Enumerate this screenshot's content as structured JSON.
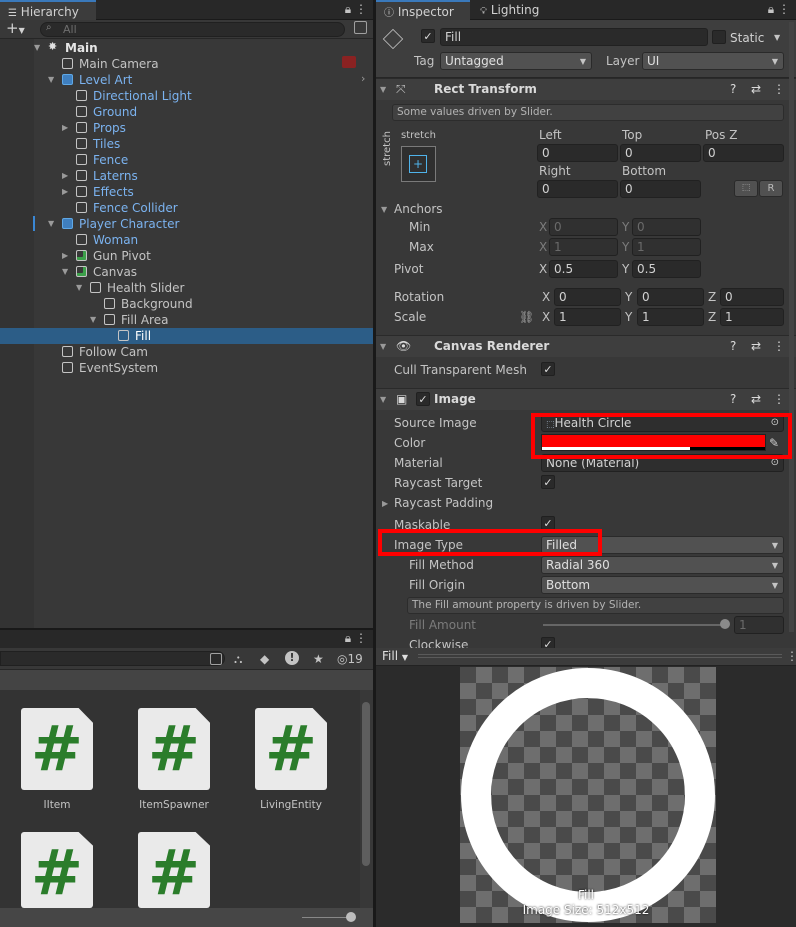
{
  "hierarchy": {
    "tab": "Hierarchy",
    "search_placeholder": "All",
    "items": [
      {
        "label": "Main",
        "indent": 0,
        "arrow": "down",
        "icon": "unity",
        "bold": true
      },
      {
        "label": "Main Camera",
        "indent": 1,
        "icon": "cube"
      },
      {
        "label": "Level Art",
        "indent": 1,
        "arrow": "down",
        "icon": "prefab",
        "blue": true
      },
      {
        "label": "Directional Light",
        "indent": 2,
        "icon": "cube",
        "blue": true
      },
      {
        "label": "Ground",
        "indent": 2,
        "icon": "cube",
        "blue": true
      },
      {
        "label": "Props",
        "indent": 2,
        "arrow": "right",
        "icon": "cube",
        "blue": true
      },
      {
        "label": "Tiles",
        "indent": 2,
        "icon": "cube",
        "blue": true
      },
      {
        "label": "Fence",
        "indent": 2,
        "icon": "cube",
        "blue": true
      },
      {
        "label": "Laterns",
        "indent": 2,
        "arrow": "right",
        "icon": "cube",
        "blue": true
      },
      {
        "label": "Effects",
        "indent": 2,
        "arrow": "right",
        "icon": "cube",
        "blue": true
      },
      {
        "label": "Fence Collider",
        "indent": 2,
        "icon": "cube",
        "blue": true
      },
      {
        "label": "Player Character",
        "indent": 1,
        "arrow": "down",
        "icon": "prefab",
        "blue": true
      },
      {
        "label": "Woman",
        "indent": 2,
        "icon": "cube",
        "blue": true
      },
      {
        "label": "Gun Pivot",
        "indent": 2,
        "arrow": "right",
        "icon": "cubeg"
      },
      {
        "label": "Canvas",
        "indent": 2,
        "arrow": "down",
        "icon": "cubeg"
      },
      {
        "label": "Health Slider",
        "indent": 3,
        "arrow": "down",
        "icon": "cube"
      },
      {
        "label": "Background",
        "indent": 4,
        "icon": "cube"
      },
      {
        "label": "Fill Area",
        "indent": 4,
        "arrow": "down",
        "icon": "cube"
      },
      {
        "label": "Fill",
        "indent": 5,
        "icon": "cube",
        "selected": true
      },
      {
        "label": "Follow Cam",
        "indent": 1,
        "icon": "cube"
      },
      {
        "label": "EventSystem",
        "indent": 1,
        "icon": "cube"
      }
    ]
  },
  "project": {
    "hidden_count": "19",
    "assets": [
      {
        "label": "IItem"
      },
      {
        "label": "ItemSpawner"
      },
      {
        "label": "LivingEntity"
      },
      {
        "label": ""
      },
      {
        "label": ""
      }
    ]
  },
  "inspector": {
    "tab_inspector": "Inspector",
    "tab_lighting": "Lighting",
    "object_name": "Fill",
    "static_label": "Static",
    "tag_label": "Tag",
    "tag_value": "Untagged",
    "layer_label": "Layer",
    "layer_value": "UI",
    "rect": {
      "title": "Rect Transform",
      "note": "Some values driven by Slider.",
      "stretch_top": "stretch",
      "stretch_side": "stretch",
      "left_label": "Left",
      "left": "0",
      "top_label": "Top",
      "top": "0",
      "posz_label": "Pos Z",
      "posz": "0",
      "right_label": "Right",
      "right": "0",
      "bottom_label": "Bottom",
      "bottom": "0",
      "r_button": "R",
      "anchors": "Anchors",
      "min": "Min",
      "min_x": "0",
      "min_y": "0",
      "max": "Max",
      "max_x": "1",
      "max_y": "1",
      "pivot": "Pivot",
      "pivot_x": "0.5",
      "pivot_y": "0.5",
      "rotation": "Rotation",
      "rot_x": "0",
      "rot_y": "0",
      "rot_z": "0",
      "scale": "Scale",
      "scale_x": "1",
      "scale_y": "1",
      "scale_z": "1",
      "x": "X",
      "y": "Y",
      "z": "Z"
    },
    "canvas_renderer": {
      "title": "Canvas Renderer",
      "cull_label": "Cull Transparent Mesh"
    },
    "image": {
      "title": "Image",
      "source_label": "Source Image",
      "source_value": "Health Circle",
      "color_label": "Color",
      "color_value": "#ff0000",
      "material_label": "Material",
      "material_value": "None (Material)",
      "raycast_target": "Raycast Target",
      "raycast_padding": "Raycast Padding",
      "maskable": "Maskable",
      "image_type_label": "Image Type",
      "image_type": "Filled",
      "fill_method_label": "Fill Method",
      "fill_method": "Radial 360",
      "fill_origin_label": "Fill Origin",
      "fill_origin": "Bottom",
      "fill_note": "The Fill amount property is driven by Slider.",
      "fill_amount_label": "Fill Amount",
      "fill_amount": "1",
      "clockwise": "Clockwise"
    }
  },
  "preview": {
    "dropdown": "Fill",
    "name": "Fill",
    "size": "Image Size: 512x512"
  }
}
